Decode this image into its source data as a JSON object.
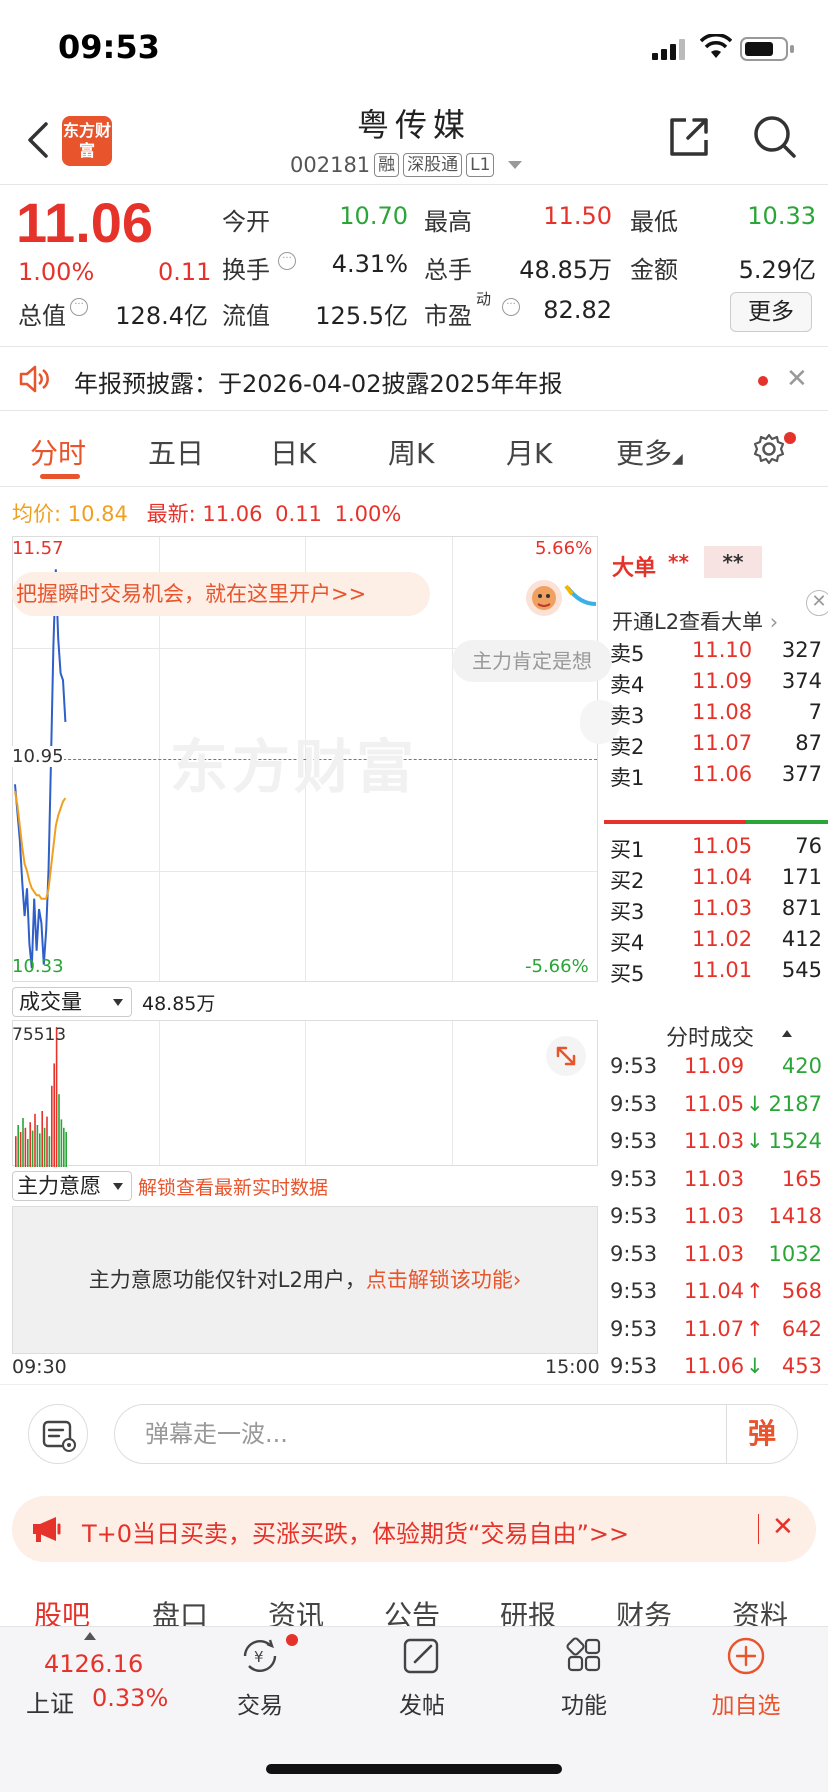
{
  "status_bar": {
    "time": "09:53"
  },
  "header": {
    "logo_text": "东方财富",
    "stock_name": "粤传媒",
    "stock_code": "002181",
    "tags": [
      "融",
      "深股通",
      "L1"
    ]
  },
  "quote": {
    "price": "11.06",
    "pct_change": "1.00%",
    "change": "0.11",
    "fields": [
      {
        "label": "今开",
        "value": "10.70",
        "color": "green"
      },
      {
        "label": "最高",
        "value": "11.50",
        "color": "red"
      },
      {
        "label": "最低",
        "value": "10.33",
        "color": "green"
      },
      {
        "label": "换手",
        "value": "4.31%",
        "color": "dark"
      },
      {
        "label": "总手",
        "value": "48.85万",
        "color": "dark"
      },
      {
        "label": "金额",
        "value": "5.29亿",
        "color": "dark"
      },
      {
        "label": "总值",
        "value": "128.4亿",
        "color": "dark"
      },
      {
        "label": "流值",
        "value": "125.5亿",
        "color": "dark"
      },
      {
        "label": "市盈",
        "label_sup": "动",
        "value": "82.82",
        "color": "dark"
      }
    ],
    "more_button": "更多"
  },
  "notice": {
    "label": "年报预披露：",
    "text": "于2026-04-02披露2025年年报"
  },
  "kline_tabs": [
    "分时",
    "五日",
    "日K",
    "周K",
    "月K",
    "更多"
  ],
  "avg_row": {
    "avg_label": "均价:",
    "avg_value": "10.84",
    "latest_label": "最新:",
    "latest_value": "11.06",
    "latest_change": "0.11",
    "latest_pct": "1.00%"
  },
  "chart": {
    "y_top": "11.57",
    "y_mid": "10.95",
    "y_bot": "10.33",
    "pct_top": "5.66%",
    "pct_bot": "-5.66%",
    "watermark": "东方财富",
    "promo": "把握瞬时交易机会，就在这里开户>>",
    "bubble": "主力肯定是想",
    "time_start": "09:30",
    "time_end": "15:00"
  },
  "chart_data": {
    "type": "line",
    "ylim": [
      10.33,
      11.57
    ],
    "series": [
      {
        "name": "最新",
        "color": "#2f5fc8",
        "values": [
          10.88,
          10.8,
          10.72,
          10.6,
          10.5,
          10.58,
          10.42,
          10.35,
          10.55,
          10.4,
          10.52,
          10.48,
          10.36,
          10.46,
          10.64,
          10.95,
          11.28,
          11.5,
          11.3,
          11.2,
          11.18,
          11.06
        ]
      },
      {
        "name": "均价",
        "color": "#f0a020",
        "values": [
          10.86,
          10.82,
          10.76,
          10.7,
          10.65,
          10.63,
          10.6,
          10.58,
          10.57,
          10.56,
          10.56,
          10.55,
          10.55,
          10.55,
          10.58,
          10.64,
          10.7,
          10.76,
          10.79,
          10.81,
          10.83,
          10.84
        ]
      }
    ],
    "volume": {
      "max_label": "75513",
      "bars": [
        {
          "v": 0.22,
          "c": "red"
        },
        {
          "v": 0.3,
          "c": "green"
        },
        {
          "v": 0.25,
          "c": "red"
        },
        {
          "v": 0.35,
          "c": "green"
        },
        {
          "v": 0.28,
          "c": "red"
        },
        {
          "v": 0.2,
          "c": "green"
        },
        {
          "v": 0.32,
          "c": "red"
        },
        {
          "v": 0.26,
          "c": "green"
        },
        {
          "v": 0.38,
          "c": "red"
        },
        {
          "v": 0.3,
          "c": "green"
        },
        {
          "v": 0.24,
          "c": "green"
        },
        {
          "v": 0.4,
          "c": "red"
        },
        {
          "v": 0.28,
          "c": "green"
        },
        {
          "v": 0.36,
          "c": "red"
        },
        {
          "v": 0.22,
          "c": "green"
        },
        {
          "v": 0.58,
          "c": "red"
        },
        {
          "v": 0.74,
          "c": "red"
        },
        {
          "v": 1.0,
          "c": "red"
        },
        {
          "v": 0.52,
          "c": "green"
        },
        {
          "v": 0.34,
          "c": "green"
        },
        {
          "v": 0.28,
          "c": "green"
        },
        {
          "v": 0.25,
          "c": "green"
        }
      ]
    }
  },
  "volume_panel": {
    "select_label": "成交量",
    "total": "48.85万"
  },
  "intent_panel": {
    "select_label": "主力意愿",
    "unlock_link": "解锁查看最新实时数据",
    "message": "主力意愿功能仅针对L2用户，",
    "message_link": "点击解锁该功能"
  },
  "order_book": {
    "title": "大单",
    "stars1": "**",
    "stars2": "**",
    "l2_link": "开通L2查看大单",
    "asks": [
      {
        "label": "卖5",
        "price": "11.10",
        "vol": "327",
        "color": "red"
      },
      {
        "label": "卖4",
        "price": "11.09",
        "vol": "374",
        "color": "red"
      },
      {
        "label": "卖3",
        "price": "11.08",
        "vol": "7",
        "color": "red"
      },
      {
        "label": "卖2",
        "price": "11.07",
        "vol": "87",
        "color": "red"
      },
      {
        "label": "卖1",
        "price": "11.06",
        "vol": "377",
        "color": "red"
      }
    ],
    "bids": [
      {
        "label": "买1",
        "price": "11.05",
        "vol": "76",
        "color": "red"
      },
      {
        "label": "买2",
        "price": "11.04",
        "vol": "171",
        "color": "red"
      },
      {
        "label": "买3",
        "price": "11.03",
        "vol": "871",
        "color": "red"
      },
      {
        "label": "买4",
        "price": "11.02",
        "vol": "412",
        "color": "red"
      },
      {
        "label": "买5",
        "price": "11.01",
        "vol": "545",
        "color": "red"
      }
    ]
  },
  "ticks": {
    "title": "分时成交",
    "rows": [
      {
        "time": "9:53",
        "price": "11.09",
        "arrow": "",
        "vol": "420",
        "vcolor": "green"
      },
      {
        "time": "9:53",
        "price": "11.05",
        "arrow": "↓",
        "vol": "2187",
        "vcolor": "green"
      },
      {
        "time": "9:53",
        "price": "11.03",
        "arrow": "↓",
        "vol": "1524",
        "vcolor": "green"
      },
      {
        "time": "9:53",
        "price": "11.03",
        "arrow": "",
        "vol": "165",
        "vcolor": "red"
      },
      {
        "time": "9:53",
        "price": "11.03",
        "arrow": "",
        "vol": "1418",
        "vcolor": "red"
      },
      {
        "time": "9:53",
        "price": "11.03",
        "arrow": "",
        "vol": "1032",
        "vcolor": "green"
      },
      {
        "time": "9:53",
        "price": "11.04",
        "arrow": "↑",
        "vol": "568",
        "vcolor": "red"
      },
      {
        "time": "9:53",
        "price": "11.07",
        "arrow": "↑",
        "vol": "642",
        "vcolor": "red"
      },
      {
        "time": "9:53",
        "price": "11.06",
        "arrow": "↓",
        "vol": "453",
        "vcolor": "red"
      }
    ]
  },
  "barrage": {
    "placeholder": "弹幕走一波...",
    "button": "弹"
  },
  "t0_banner": {
    "text": "T+0当日买卖，买涨买跌，体验期货“交易自由”>>"
  },
  "bottom_tabs": [
    "股吧",
    "盘口",
    "资讯",
    "公告",
    "研报",
    "财务",
    "资料"
  ],
  "nav": {
    "index_value": "4126.16",
    "index_name": "上证",
    "index_pct": "0.33%",
    "items": [
      "交易",
      "发帖",
      "功能",
      "加自选"
    ]
  },
  "colors": {
    "up": "#e5332b",
    "down": "#2aa537",
    "accent": "#e8542c",
    "avg_line": "#f0a020",
    "price_line": "#2f5fc8"
  }
}
